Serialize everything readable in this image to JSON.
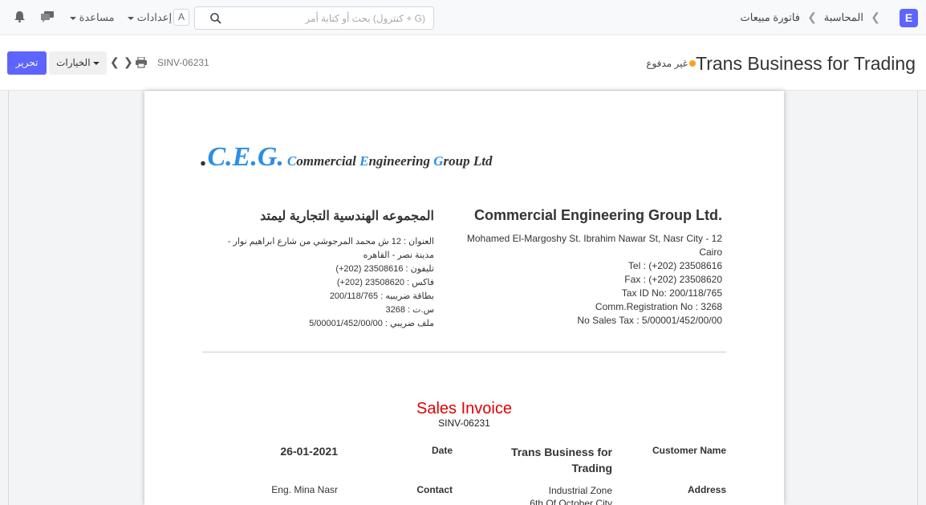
{
  "navbar": {
    "logo_letter": "E",
    "breadcrumbs": [
      "المحاسبة",
      "فاتورة مبيعات"
    ],
    "search_placeholder": "بحث أو كتابة أمر (كنترول + G)",
    "avatar_letter": "A",
    "settings_label": "إعدادات",
    "help_label": "مساعدة"
  },
  "pagehead": {
    "title": "Trans Business for Trading",
    "status": "غير مدفوع",
    "doc_name": "SINV-06231",
    "options_label": "الخيارات",
    "edit_label": "تحرير"
  },
  "colors": {
    "accent": "#5e64ff",
    "status_dot": "#ff9f1a",
    "invoice_title": "#e00000",
    "logo_blue": "#2b8fe6"
  },
  "letterhead": {
    "logo_big": "C.E.G.",
    "logo_dot": ".",
    "logo_words": [
      {
        "first": "C",
        "rest": "ommercial "
      },
      {
        "first": "E",
        "rest": "ngineering "
      },
      {
        "first": "G",
        "rest": "roup Ltd"
      }
    ],
    "en_name": "Commercial Engineering Group Ltd.",
    "en_lines": [
      "Mohamed El-Margoshy St. Ibrahim Nawar St, Nasr City - 12",
      "Cairo",
      "Tel : (+202) 23508616",
      "Fax : (+202) 23508620",
      "Tax ID No: 200/118/765",
      "Comm.Registration No : 3268",
      "No Sales Tax : 5/00001/452/00/00"
    ],
    "ar_name": "المجموعه الهندسية التجارية ليمتد",
    "ar_lines": [
      "العنوان : 12 ش محمد المرجوشي من شارع ابراهيم نوار - مدينة نصر - القاهره",
      "تليفون : 23508616 (202+)",
      "فاكس : 23508620 (202+)",
      "بطاقة ضريبيه : 200/118/765",
      "س.ت : 3268",
      "ملف ضريبي : 5/00001/452/00/00"
    ]
  },
  "invoice": {
    "title": "Sales Invoice",
    "number": "SINV-06231",
    "customer_name_label": "Customer Name",
    "customer_name_line1": "Trans Business for",
    "customer_name_line2": "Trading",
    "date_label": "Date",
    "date_value": "26-01-2021",
    "address_label": "Address",
    "address_line1": "Industrial Zone",
    "address_line2": "6th Of October City",
    "contact_label": "Contact",
    "contact_value": "Eng. Mina Nasr"
  }
}
